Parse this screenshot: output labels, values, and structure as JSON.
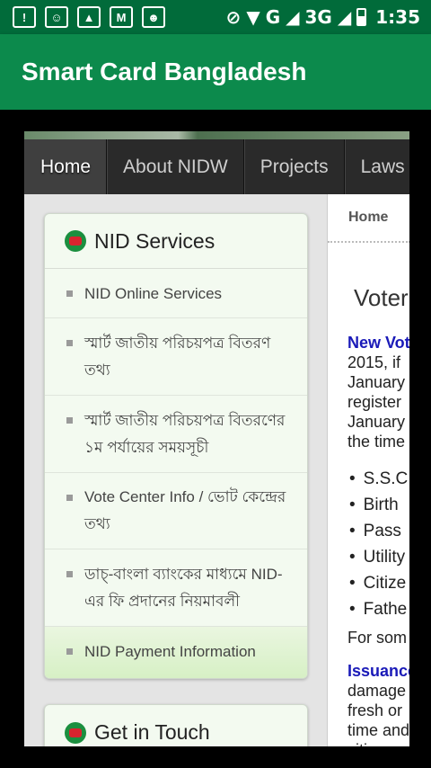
{
  "status_bar": {
    "network": "G",
    "network2": "3G",
    "time": "1:35",
    "icons": [
      "alert-icon",
      "face-notification-icon",
      "image-icon",
      "gmail-icon",
      "message-icon",
      "dnd-icon",
      "wifi-icon",
      "signal-icon",
      "signal-icon",
      "battery-icon"
    ]
  },
  "app_bar": {
    "title": "Smart Card Bangladesh"
  },
  "nav": {
    "items": [
      "Home",
      "About NIDW",
      "Projects",
      "Laws"
    ]
  },
  "breadcrumb": "Home",
  "sidebar": {
    "services_title": "NID Services",
    "services": [
      "NID Online Services",
      "স্মার্ট জাতীয় পরিচয়পত্র বিতরণ তথ্য",
      "স্মার্ট জাতীয় পরিচয়পত্র বিতরণের ১ম পর্যায়ের সময়সূচী",
      "Vote Center Info / ভোট কেন্দ্রের তথ্য",
      "ডাচ্-বাংলা ব্যাংকের মাধ্যমে NID-এর ফি প্রদানের নিয়মাবলী",
      "NID Payment Information"
    ],
    "contact_title": "Get in Touch"
  },
  "main": {
    "title": "Voter",
    "para1_link": "New Vot",
    "para1_lines": [
      "2015, if",
      "January",
      "register",
      "January",
      "the time"
    ],
    "documents": [
      "S.S.C",
      "Birth",
      "Pass",
      "Utility",
      "Citize",
      "Fathe"
    ],
    "para2": "For som",
    "para3_link": "Issuance",
    "para3_lines": [
      "damage",
      "fresh or",
      "time and",
      "citizen"
    ]
  }
}
